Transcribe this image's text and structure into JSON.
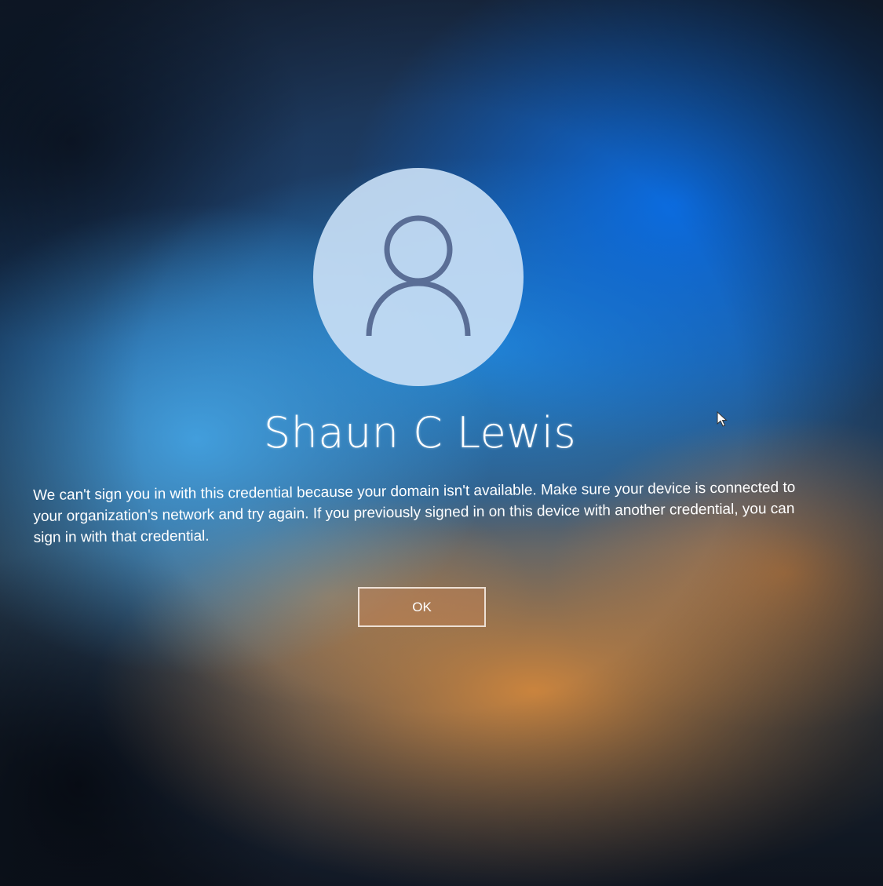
{
  "user": {
    "name": "Shaun C Lewis",
    "avatar_icon": "user-silhouette-icon"
  },
  "message": {
    "text": "We can't sign you in with this credential because your domain isn't available. Make sure your device is connected to your organization's network and try again. If you previously signed in on this device with another credential, you can sign in with that credential."
  },
  "actions": {
    "ok_label": "OK"
  },
  "pointer": {
    "icon": "mouse-cursor-icon"
  },
  "colors": {
    "avatar_bg": "#c8def5",
    "avatar_stroke": "#5a6e96",
    "button_bg": "#be8255",
    "text": "#ffffff"
  }
}
